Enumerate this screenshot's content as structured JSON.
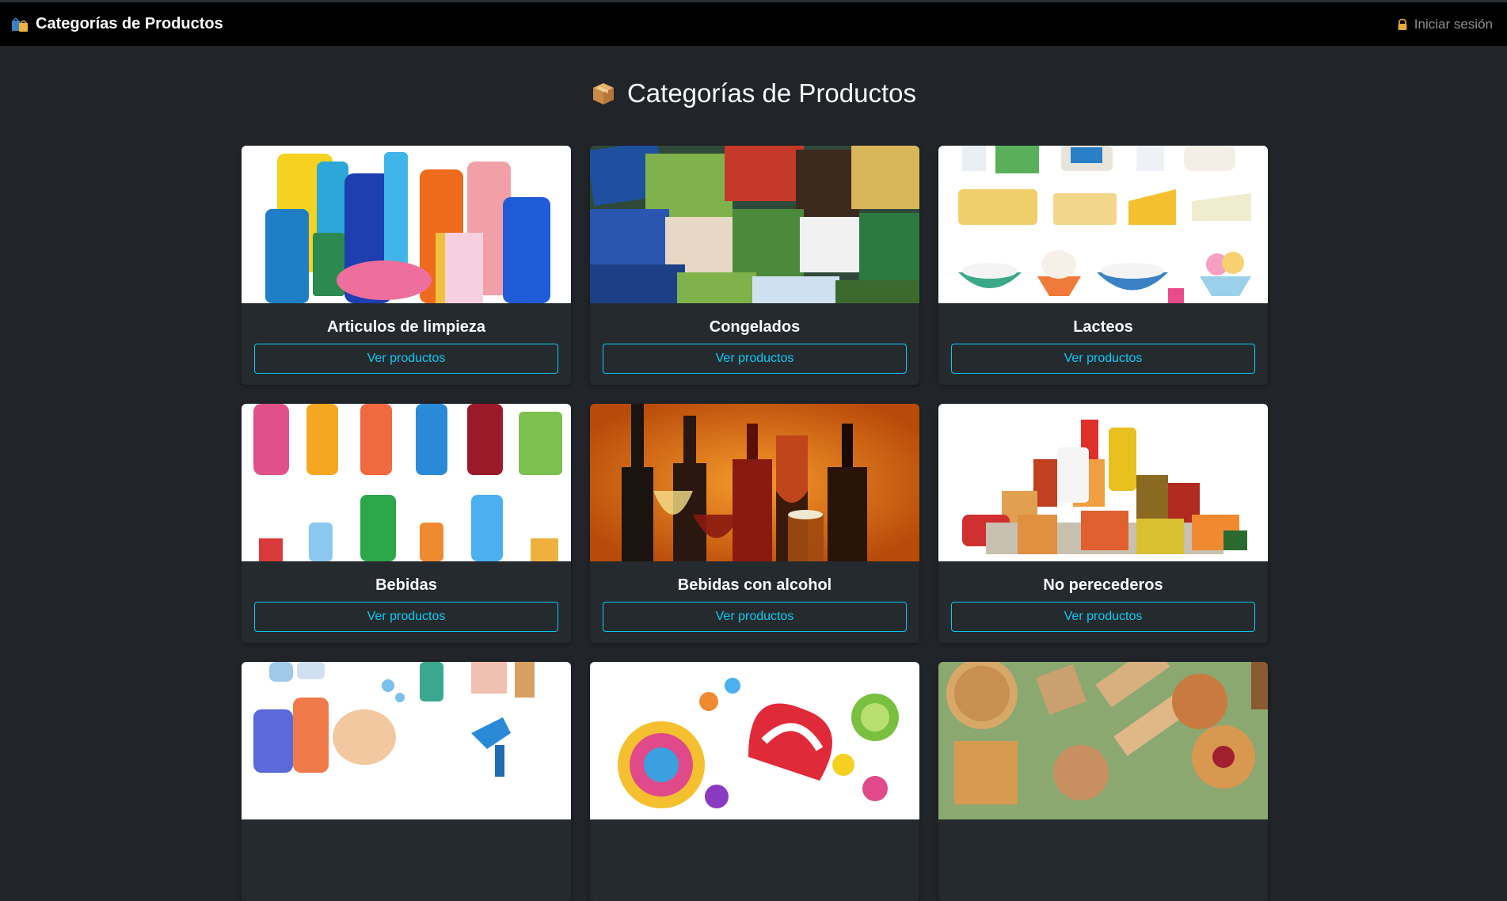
{
  "navbar": {
    "brand_icon": "shopping-bags-icon",
    "brand_title": "Categorías de Productos",
    "login_icon": "lock-icon",
    "login_label": "Iniciar sesión"
  },
  "page": {
    "heading_icon": "package-box-icon",
    "heading": "Categorías de Productos"
  },
  "colors": {
    "background": "#212529",
    "navbar": "#000000",
    "card": "#252a2f",
    "accent": "#0dcaf0"
  },
  "categories": [
    {
      "name": "Articulos de limpieza",
      "button": "Ver productos",
      "image": "cleaning-products-image"
    },
    {
      "name": "Congelados",
      "button": "Ver productos",
      "image": "frozen-food-image"
    },
    {
      "name": "Lacteos",
      "button": "Ver productos",
      "image": "dairy-products-image"
    },
    {
      "name": "Bebidas",
      "button": "Ver productos",
      "image": "beverages-image"
    },
    {
      "name": "Bebidas con alcohol",
      "button": "Ver productos",
      "image": "alcoholic-drinks-image"
    },
    {
      "name": "No perecederos",
      "button": "Ver productos",
      "image": "canned-goods-image"
    },
    {
      "name": "",
      "button": "",
      "image": "hygiene-products-image"
    },
    {
      "name": "",
      "button": "",
      "image": "candy-lollipops-image"
    },
    {
      "name": "",
      "button": "",
      "image": "cookies-biscuits-image"
    }
  ]
}
